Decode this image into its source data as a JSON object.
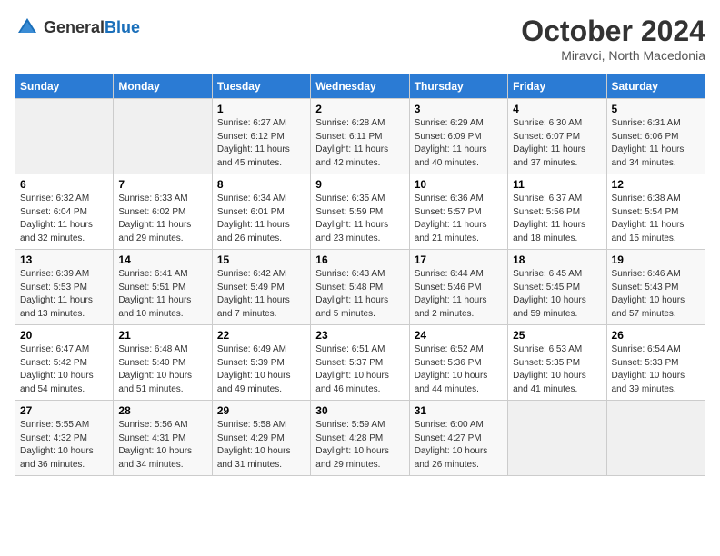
{
  "header": {
    "logo_general": "General",
    "logo_blue": "Blue",
    "month_title": "October 2024",
    "subtitle": "Miravci, North Macedonia"
  },
  "calendar": {
    "days_of_week": [
      "Sunday",
      "Monday",
      "Tuesday",
      "Wednesday",
      "Thursday",
      "Friday",
      "Saturday"
    ],
    "weeks": [
      [
        {
          "day": "",
          "empty": true
        },
        {
          "day": "",
          "empty": true
        },
        {
          "day": "1",
          "sunrise": "6:27 AM",
          "sunset": "6:12 PM",
          "daylight": "11 hours and 45 minutes."
        },
        {
          "day": "2",
          "sunrise": "6:28 AM",
          "sunset": "6:11 PM",
          "daylight": "11 hours and 42 minutes."
        },
        {
          "day": "3",
          "sunrise": "6:29 AM",
          "sunset": "6:09 PM",
          "daylight": "11 hours and 40 minutes."
        },
        {
          "day": "4",
          "sunrise": "6:30 AM",
          "sunset": "6:07 PM",
          "daylight": "11 hours and 37 minutes."
        },
        {
          "day": "5",
          "sunrise": "6:31 AM",
          "sunset": "6:06 PM",
          "daylight": "11 hours and 34 minutes."
        }
      ],
      [
        {
          "day": "6",
          "sunrise": "6:32 AM",
          "sunset": "6:04 PM",
          "daylight": "11 hours and 32 minutes."
        },
        {
          "day": "7",
          "sunrise": "6:33 AM",
          "sunset": "6:02 PM",
          "daylight": "11 hours and 29 minutes."
        },
        {
          "day": "8",
          "sunrise": "6:34 AM",
          "sunset": "6:01 PM",
          "daylight": "11 hours and 26 minutes."
        },
        {
          "day": "9",
          "sunrise": "6:35 AM",
          "sunset": "5:59 PM",
          "daylight": "11 hours and 23 minutes."
        },
        {
          "day": "10",
          "sunrise": "6:36 AM",
          "sunset": "5:57 PM",
          "daylight": "11 hours and 21 minutes."
        },
        {
          "day": "11",
          "sunrise": "6:37 AM",
          "sunset": "5:56 PM",
          "daylight": "11 hours and 18 minutes."
        },
        {
          "day": "12",
          "sunrise": "6:38 AM",
          "sunset": "5:54 PM",
          "daylight": "11 hours and 15 minutes."
        }
      ],
      [
        {
          "day": "13",
          "sunrise": "6:39 AM",
          "sunset": "5:53 PM",
          "daylight": "11 hours and 13 minutes."
        },
        {
          "day": "14",
          "sunrise": "6:41 AM",
          "sunset": "5:51 PM",
          "daylight": "11 hours and 10 minutes."
        },
        {
          "day": "15",
          "sunrise": "6:42 AM",
          "sunset": "5:49 PM",
          "daylight": "11 hours and 7 minutes."
        },
        {
          "day": "16",
          "sunrise": "6:43 AM",
          "sunset": "5:48 PM",
          "daylight": "11 hours and 5 minutes."
        },
        {
          "day": "17",
          "sunrise": "6:44 AM",
          "sunset": "5:46 PM",
          "daylight": "11 hours and 2 minutes."
        },
        {
          "day": "18",
          "sunrise": "6:45 AM",
          "sunset": "5:45 PM",
          "daylight": "10 hours and 59 minutes."
        },
        {
          "day": "19",
          "sunrise": "6:46 AM",
          "sunset": "5:43 PM",
          "daylight": "10 hours and 57 minutes."
        }
      ],
      [
        {
          "day": "20",
          "sunrise": "6:47 AM",
          "sunset": "5:42 PM",
          "daylight": "10 hours and 54 minutes."
        },
        {
          "day": "21",
          "sunrise": "6:48 AM",
          "sunset": "5:40 PM",
          "daylight": "10 hours and 51 minutes."
        },
        {
          "day": "22",
          "sunrise": "6:49 AM",
          "sunset": "5:39 PM",
          "daylight": "10 hours and 49 minutes."
        },
        {
          "day": "23",
          "sunrise": "6:51 AM",
          "sunset": "5:37 PM",
          "daylight": "10 hours and 46 minutes."
        },
        {
          "day": "24",
          "sunrise": "6:52 AM",
          "sunset": "5:36 PM",
          "daylight": "10 hours and 44 minutes."
        },
        {
          "day": "25",
          "sunrise": "6:53 AM",
          "sunset": "5:35 PM",
          "daylight": "10 hours and 41 minutes."
        },
        {
          "day": "26",
          "sunrise": "6:54 AM",
          "sunset": "5:33 PM",
          "daylight": "10 hours and 39 minutes."
        }
      ],
      [
        {
          "day": "27",
          "sunrise": "5:55 AM",
          "sunset": "4:32 PM",
          "daylight": "10 hours and 36 minutes."
        },
        {
          "day": "28",
          "sunrise": "5:56 AM",
          "sunset": "4:31 PM",
          "daylight": "10 hours and 34 minutes."
        },
        {
          "day": "29",
          "sunrise": "5:58 AM",
          "sunset": "4:29 PM",
          "daylight": "10 hours and 31 minutes."
        },
        {
          "day": "30",
          "sunrise": "5:59 AM",
          "sunset": "4:28 PM",
          "daylight": "10 hours and 29 minutes."
        },
        {
          "day": "31",
          "sunrise": "6:00 AM",
          "sunset": "4:27 PM",
          "daylight": "10 hours and 26 minutes."
        },
        {
          "day": "",
          "empty": true
        },
        {
          "day": "",
          "empty": true
        }
      ]
    ]
  }
}
